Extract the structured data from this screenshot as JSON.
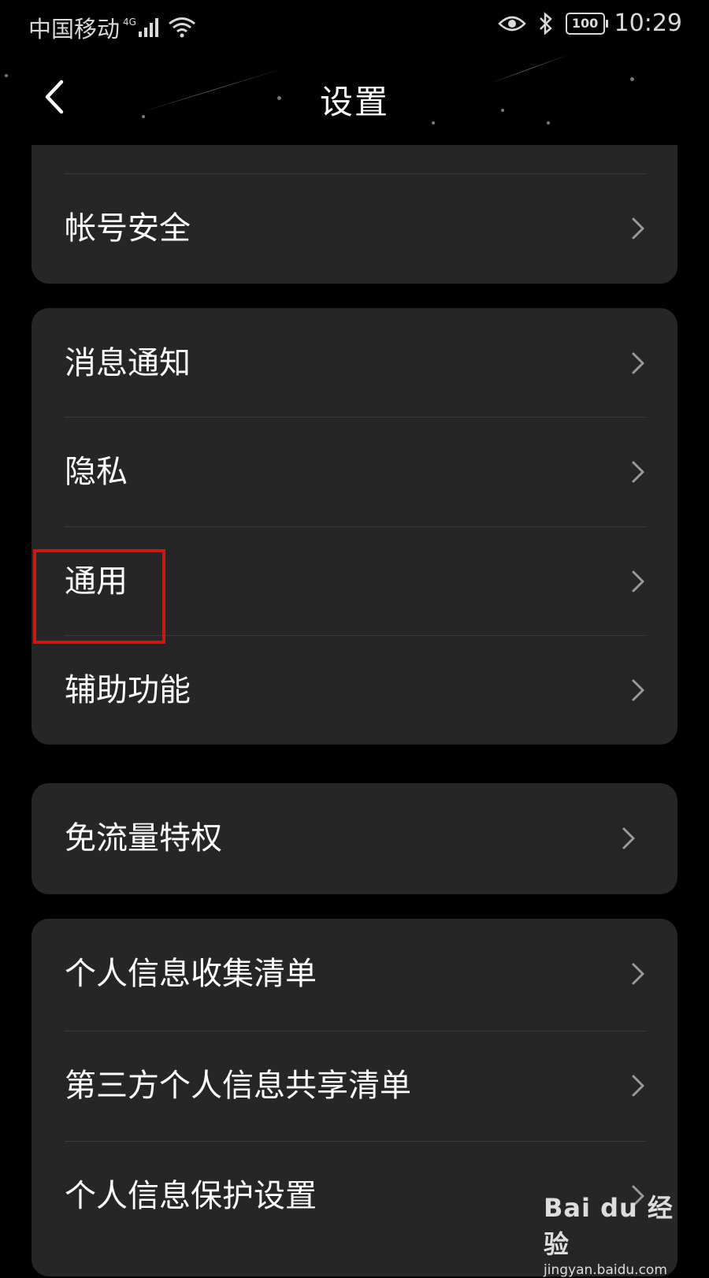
{
  "status_bar": {
    "carrier": "中国移动",
    "network": "4G",
    "battery": "100",
    "time": "10:29"
  },
  "header": {
    "title": "设置"
  },
  "groups": [
    {
      "items": [
        {
          "label": "帐号安全"
        }
      ]
    },
    {
      "items": [
        {
          "label": "消息通知"
        },
        {
          "label": "隐私"
        },
        {
          "label": "通用"
        },
        {
          "label": "辅助功能"
        }
      ]
    },
    {
      "items": [
        {
          "label": "免流量特权"
        }
      ]
    },
    {
      "items": [
        {
          "label": "个人信息收集清单"
        },
        {
          "label": "第三方个人信息共享清单"
        },
        {
          "label": "个人信息保护设置"
        }
      ]
    }
  ],
  "highlighted_item": "通用",
  "watermark": {
    "logo": "Bai du 经验",
    "url": "jingyan.baidu.com"
  },
  "colors": {
    "background": "#000000",
    "card": "#262626",
    "highlight": "#c41a1a"
  }
}
